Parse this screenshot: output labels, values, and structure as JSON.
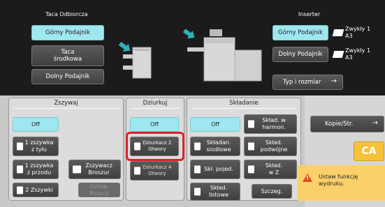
{
  "output": {
    "tray_label": "Taca Odbiorcza",
    "upper_tray": "Górny Podajnik",
    "middle_tray": "Taca\nśrodkowa",
    "lower_tray": "Dolny Podajnik"
  },
  "inserter": {
    "label": "Inserter",
    "upper": "Górny Podajnik",
    "lower": "Dolny Podajnik",
    "upper_paper": "Zwykły 1\nA3",
    "lower_paper": "Zwykły 1\nA3",
    "type_size": "Typ i rozmiar"
  },
  "staple": {
    "title": "Zszywaj",
    "off": "Off",
    "back1": "1 zszywka\nz tyłu",
    "front1": "1 zszywka\nz przodu",
    "two": "2 Zszywki",
    "saddle": "Zszywacz\nBroszur",
    "pin": "Ustaw.\nPozycji"
  },
  "punch": {
    "title": "Dziurkuj",
    "off": "Off",
    "two_holes": "Dziurkacz 2\nOtwory",
    "four_holes": "Dziurkacz 4\nOtwory"
  },
  "fold": {
    "title": "Składanie",
    "off": "Off",
    "harmonica": "Skład. w\nharmon.",
    "saddle": "Składan.\nsiodłowe",
    "double": "Skład.\npodwójne",
    "single": "Skł. pojed.",
    "z": "Skład.\nw Z",
    "letter": "Skład.\nlistowe",
    "details": "Szczeg."
  },
  "side": {
    "copies": "Kopie/Str.",
    "ca": "CA",
    "warning": "Ustaw funkcję\nwydruku."
  },
  "colors": {
    "accent": "#9fe7f0",
    "highlight": "#e0202a",
    "warning": "#fbd06a"
  }
}
